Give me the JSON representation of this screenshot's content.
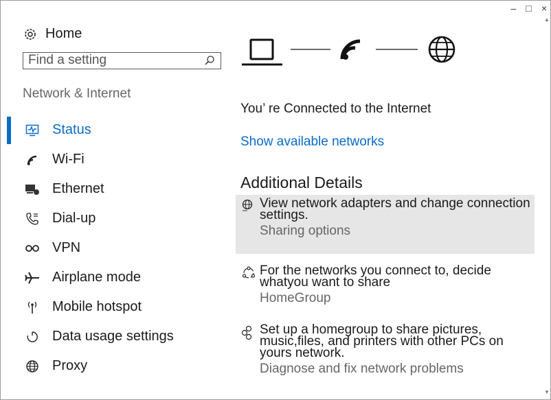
{
  "window": {
    "minimize": "–",
    "maximize": "□",
    "close": "×"
  },
  "sidebar": {
    "home_label": "Home",
    "search_placeholder": "Find a setting",
    "section_title": "Network & Internet",
    "items": [
      {
        "label": "Status",
        "icon": "status-icon",
        "active": true
      },
      {
        "label": "Wi-Fi",
        "icon": "wifi-icon"
      },
      {
        "label": "Ethernet",
        "icon": "ethernet-icon"
      },
      {
        "label": "Dial-up",
        "icon": "dialup-icon"
      },
      {
        "label": "VPN",
        "icon": "vpn-icon"
      },
      {
        "label": "Airplane mode",
        "icon": "airplane-icon"
      },
      {
        "label": "Mobile hotspot",
        "icon": "hotspot-icon"
      },
      {
        "label": "Data usage settings",
        "icon": "data-usage-icon"
      },
      {
        "label": "Proxy",
        "icon": "globe-icon"
      }
    ]
  },
  "main": {
    "status_text": "You’ re Connected to the Internet",
    "show_networks_link": "Show available networks",
    "details_heading": "Additional Details",
    "details": [
      {
        "text": "View network adapters and change connection settings.",
        "sub": "Sharing options",
        "icon": "network-adapter-icon",
        "highlighted": true
      },
      {
        "text": "For the networks you connect to, decide whatyou want to share",
        "sub": "HomeGroup",
        "icon": "sharing-icon",
        "highlighted": false
      },
      {
        "text": "Set up a homegroup to share pictures, music,files, and printers with other PCs on yours network.",
        "sub": "Diagnose and fix network problems",
        "icon": "homegroup-icon",
        "highlighted": false
      }
    ]
  },
  "colors": {
    "accent": "#0a6bc8",
    "highlight": "#e6e6e6"
  }
}
